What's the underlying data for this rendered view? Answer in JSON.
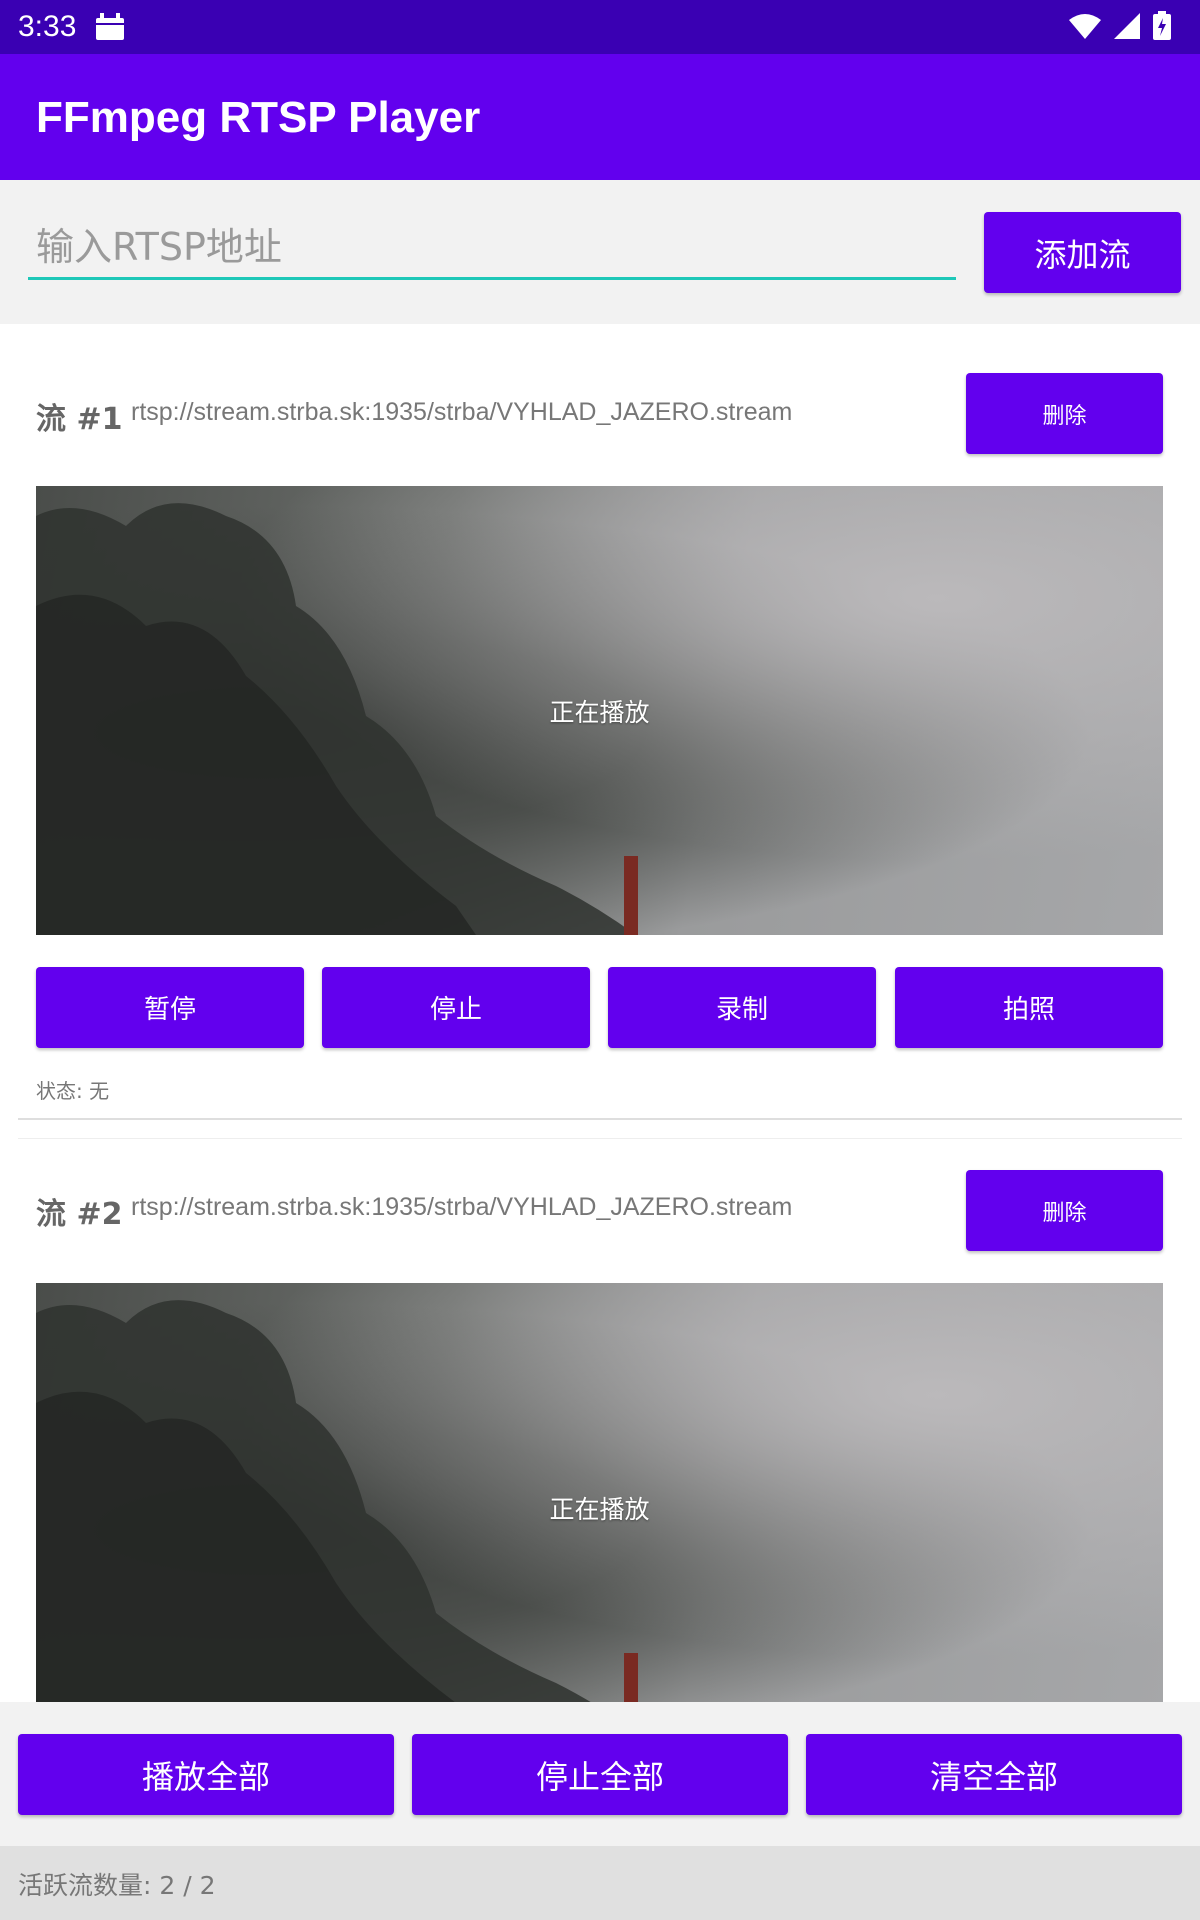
{
  "status_bar": {
    "time": "3:33",
    "icons": [
      "calendar-icon",
      "wifi-icon",
      "signal-icon",
      "battery-charging-icon"
    ]
  },
  "app_bar": {
    "title": "FFmpeg RTSP Player"
  },
  "input": {
    "placeholder": "输入RTSP地址",
    "value": "",
    "add_button": "添加流"
  },
  "streams": [
    {
      "label": "流 #1",
      "url": "rtsp://stream.strba.sk:1935/strba/VYHLAD_JAZERO.stream",
      "delete_label": "删除",
      "video_status": "正在播放",
      "controls": [
        "暂停",
        "停止",
        "录制",
        "拍照"
      ],
      "status": "状态: 无"
    },
    {
      "label": "流 #2",
      "url": "rtsp://stream.strba.sk:1935/strba/VYHLAD_JAZERO.stream",
      "delete_label": "删除",
      "video_status": "正在播放"
    }
  ],
  "bottom_actions": [
    "播放全部",
    "停止全部",
    "清空全部"
  ],
  "footer": {
    "active_count": "活跃流数量: 2 / 2"
  },
  "colors": {
    "primary": "#6200ee",
    "status_bar": "#3a00b3",
    "input_underline": "#1ec8b8"
  }
}
